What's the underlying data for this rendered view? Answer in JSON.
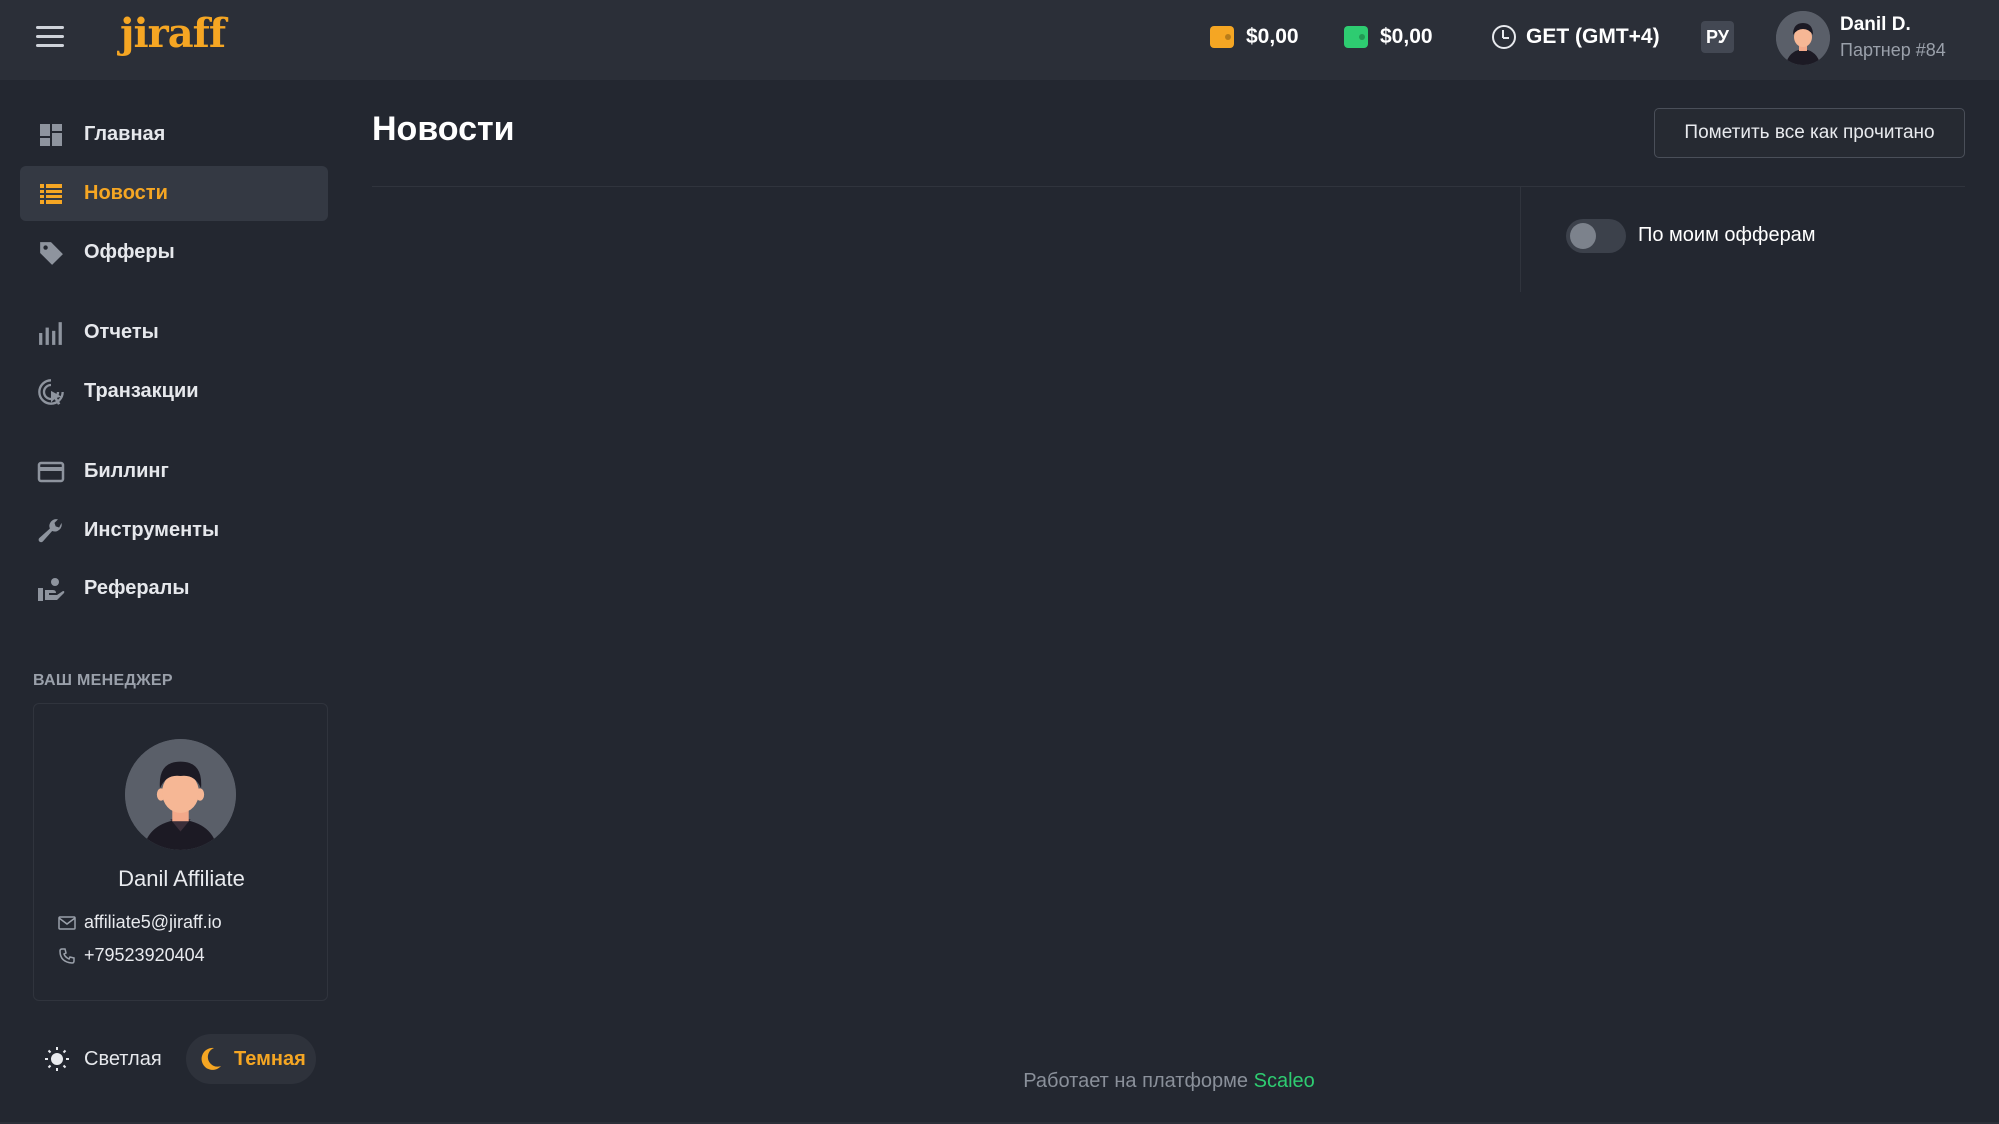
{
  "header": {
    "logo": "jiraff",
    "balance_1": "$0,00",
    "balance_2": "$0,00",
    "timezone": "GET (GMT+4)",
    "language": "РУ",
    "user_name": "Danil D.",
    "user_role": "Партнер #84"
  },
  "sidebar": {
    "items": [
      {
        "label": "Главная",
        "icon": "dashboard-icon"
      },
      {
        "label": "Новости",
        "icon": "news-icon"
      },
      {
        "label": "Офферы",
        "icon": "tag-icon"
      },
      {
        "label": "Отчеты",
        "icon": "bar-chart-icon"
      },
      {
        "label": "Транзакции",
        "icon": "transactions-icon"
      },
      {
        "label": "Биллинг",
        "icon": "credit-card-icon"
      },
      {
        "label": "Инструменты",
        "icon": "wrench-icon"
      },
      {
        "label": "Рефералы",
        "icon": "referrals-icon"
      }
    ],
    "active_item": "Новости",
    "manager": {
      "title": "ВАШ МЕНЕДЖЕР",
      "name": "Danil Affiliate",
      "email": "affiliate5@jiraff.io",
      "phone": "+79523920404"
    },
    "theme": {
      "light_label": "Светлая",
      "dark_label": "Темная",
      "selected": "Темная"
    }
  },
  "main": {
    "title": "Новости",
    "mark_all_read": "Пометить все как прочитано",
    "filter_toggle_label": "По моим офферам",
    "filter_toggle_on": false
  },
  "footer": {
    "text": "Работает на платформе",
    "brand": "Scaleo"
  },
  "colors": {
    "accent": "#f5a623",
    "brand_green": "#2ecc71",
    "background": "#232730",
    "topbar": "#2b2f38"
  }
}
